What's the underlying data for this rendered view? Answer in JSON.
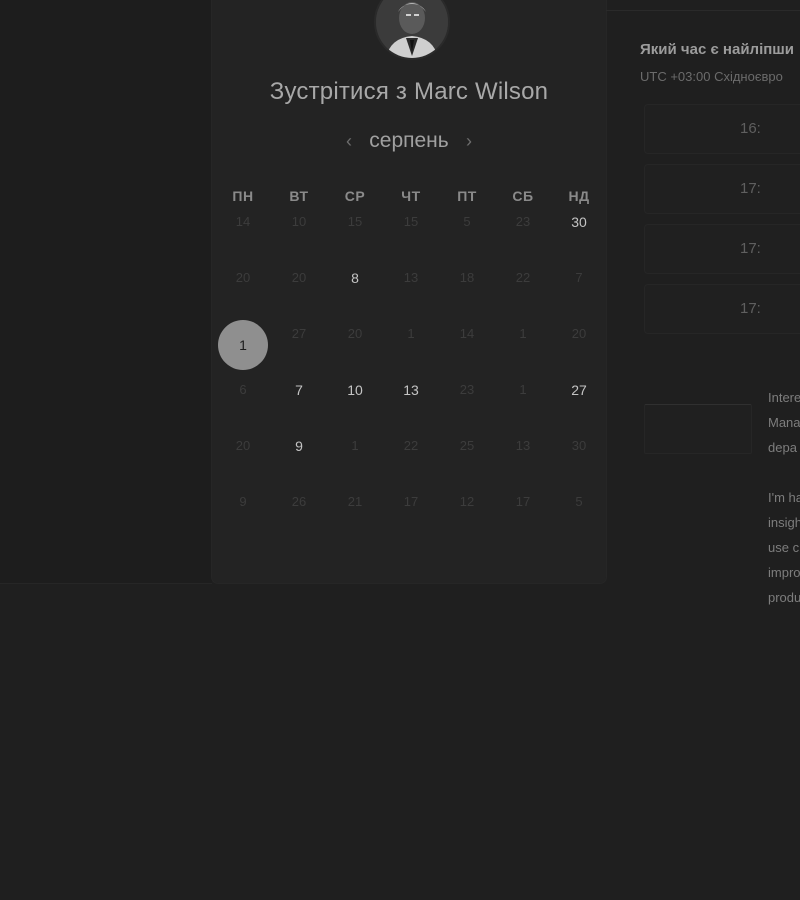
{
  "card": {
    "title": "Зустрітися з Marc Wilson",
    "month": "серпень",
    "prev_icon": "chevron-left-icon",
    "next_icon": "chevron-right-icon"
  },
  "weekdays": [
    "ПН",
    "ВТ",
    "СР",
    "ЧТ",
    "ПТ",
    "СБ",
    "НД"
  ],
  "days": [
    {
      "label": "14",
      "state": "disabled"
    },
    {
      "label": "10",
      "state": "disabled"
    },
    {
      "label": "15",
      "state": "disabled"
    },
    {
      "label": "15",
      "state": "disabled"
    },
    {
      "label": "5",
      "state": "disabled"
    },
    {
      "label": "23",
      "state": "disabled"
    },
    {
      "label": "30",
      "state": "available"
    },
    {
      "label": "20",
      "state": "disabled"
    },
    {
      "label": "20",
      "state": "disabled"
    },
    {
      "label": "8",
      "state": "available"
    },
    {
      "label": "13",
      "state": "disabled"
    },
    {
      "label": "18",
      "state": "disabled"
    },
    {
      "label": "22",
      "state": "disabled"
    },
    {
      "label": "7",
      "state": "disabled"
    },
    {
      "label": "1",
      "state": "selected"
    },
    {
      "label": "27",
      "state": "disabled"
    },
    {
      "label": "20",
      "state": "disabled"
    },
    {
      "label": "1",
      "state": "disabled"
    },
    {
      "label": "14",
      "state": "disabled"
    },
    {
      "label": "1",
      "state": "disabled"
    },
    {
      "label": "20",
      "state": "disabled"
    },
    {
      "label": "6",
      "state": "disabled"
    },
    {
      "label": "7",
      "state": "available"
    },
    {
      "label": "10",
      "state": "available"
    },
    {
      "label": "13",
      "state": "available"
    },
    {
      "label": "23",
      "state": "disabled"
    },
    {
      "label": "1",
      "state": "disabled"
    },
    {
      "label": "27",
      "state": "available"
    },
    {
      "label": "20",
      "state": "disabled"
    },
    {
      "label": "9",
      "state": "available"
    },
    {
      "label": "1",
      "state": "disabled"
    },
    {
      "label": "22",
      "state": "disabled"
    },
    {
      "label": "25",
      "state": "disabled"
    },
    {
      "label": "13",
      "state": "disabled"
    },
    {
      "label": "30",
      "state": "disabled"
    },
    {
      "label": "9",
      "state": "disabled"
    },
    {
      "label": "26",
      "state": "disabled"
    },
    {
      "label": "21",
      "state": "disabled"
    },
    {
      "label": "17",
      "state": "disabled"
    },
    {
      "label": "12",
      "state": "disabled"
    },
    {
      "label": "17",
      "state": "disabled"
    },
    {
      "label": "5",
      "state": "disabled"
    }
  ],
  "right": {
    "question": "Який час є найліпши",
    "timezone": "UTC +03:00 Східноєвро",
    "slots": [
      "16:",
      "17:",
      "17:",
      "17:"
    ],
    "description_1": [
      "Intere",
      "Mana",
      "depa"
    ],
    "description_2": [
      "I'm ha",
      "insigh",
      "use c",
      "impro",
      "produ"
    ]
  },
  "colors": {
    "background": "#1f1f1f",
    "card": "#232323",
    "selected_day": "#8f8f8f"
  }
}
